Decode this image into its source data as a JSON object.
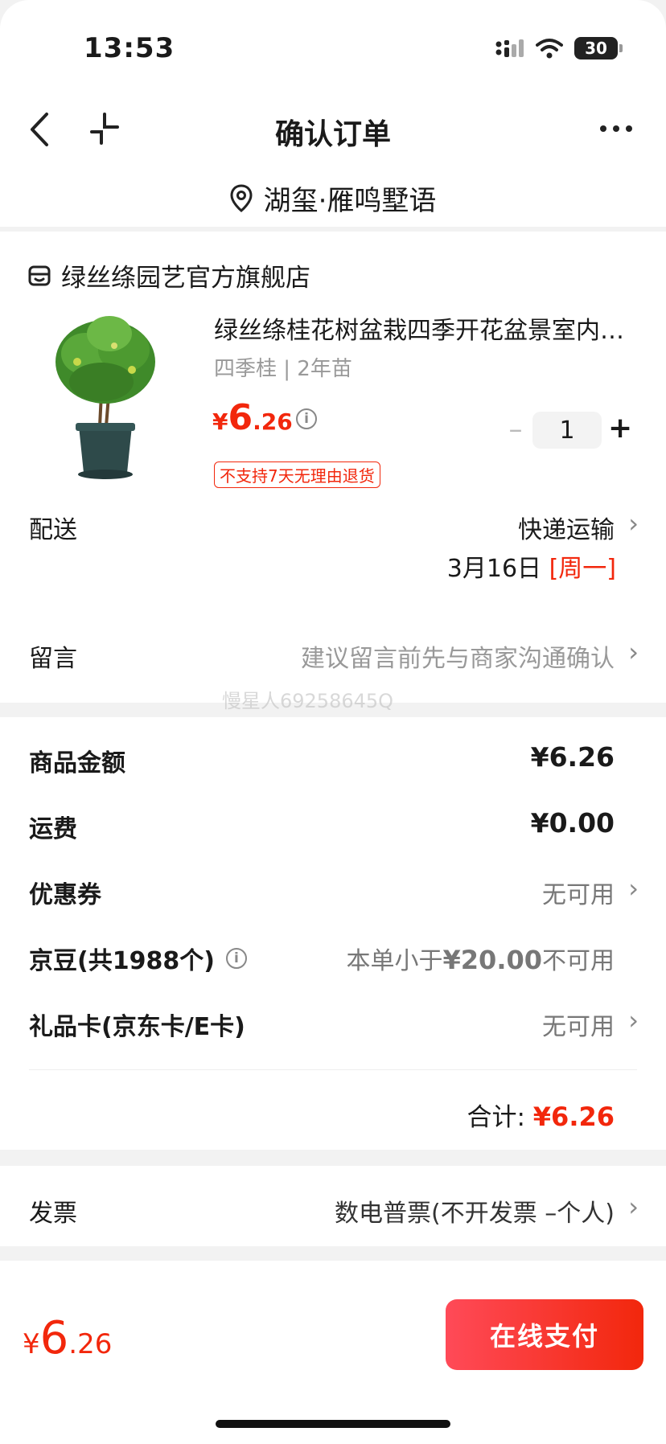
{
  "status_bar": {
    "time": "13:53",
    "battery": "30"
  },
  "header": {
    "title": "确认订单",
    "address": "湖玺·雁鸣墅语"
  },
  "order": {
    "store_name": "绿丝绦园艺官方旗舰店",
    "product_title": "绿丝绦桂花树盆栽四季开花盆景室内庭院浓香型",
    "product_spec": "四季桂 | 2年苗",
    "price_symbol": "¥",
    "price_int": "6",
    "price_dec": ".26",
    "quantity": "1",
    "return_policy": "不支持7天无理由退货"
  },
  "delivery": {
    "label": "配送",
    "method": "快递运输",
    "date": "3月16日",
    "weekday": "[周一]"
  },
  "note": {
    "label": "留言",
    "placeholder": "建议留言前先与商家沟通确认"
  },
  "watermark": "慢星人69258645Q",
  "summary": {
    "goods_label": "商品金额",
    "goods_value": "¥6.26",
    "shipping_label": "运费",
    "shipping_value": "¥0.00",
    "coupon_label": "优惠券",
    "coupon_value": "无可用",
    "beans_label": "京豆(共1988个)",
    "beans_value_prefix": "本单小于",
    "beans_value_amount": "¥20.00",
    "beans_value_suffix": "不可用",
    "giftcard_label": "礼品卡(京东卡/E卡)",
    "giftcard_value": "无可用",
    "total_label": "合计:",
    "total_value": "¥6.26"
  },
  "invoice": {
    "label": "发票",
    "value": "数电普票(不开发票 –个人)"
  },
  "bottom_bar": {
    "price_symbol": "¥",
    "price_int": "6",
    "price_dec": ".26",
    "pay_label": "在线支付"
  },
  "colors": {
    "accent": "#f2270c",
    "pay_button_start": "#ff4a58"
  }
}
